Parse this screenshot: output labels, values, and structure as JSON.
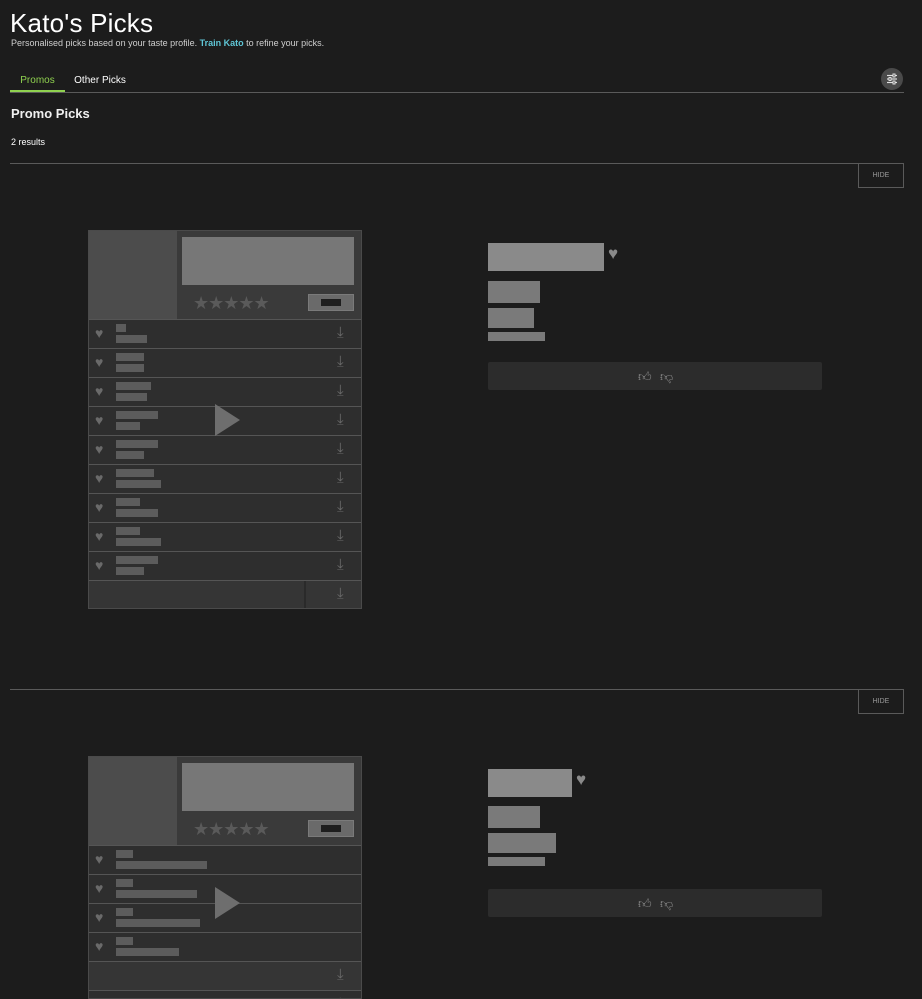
{
  "header": {
    "title": "Kato's Picks",
    "subtitle_before": "Personalised picks based on your taste profile. ",
    "subtitle_link": "Train Kato",
    "subtitle_after": " to refine your picks."
  },
  "tabs": [
    {
      "label": "Promos",
      "active": true
    },
    {
      "label": "Other Picks",
      "active": false
    }
  ],
  "filter_button": {
    "icon": "sliders-icon"
  },
  "section": {
    "title": "Promo Picks",
    "results": "2 results"
  },
  "cards": [
    {
      "hide_label": "HIDE"
    },
    {
      "hide_label": "HIDE"
    }
  ],
  "colors": {
    "accent_green": "#8fd14f",
    "link_cyan": "#5fc6d6",
    "background": "#1c1c1c"
  }
}
